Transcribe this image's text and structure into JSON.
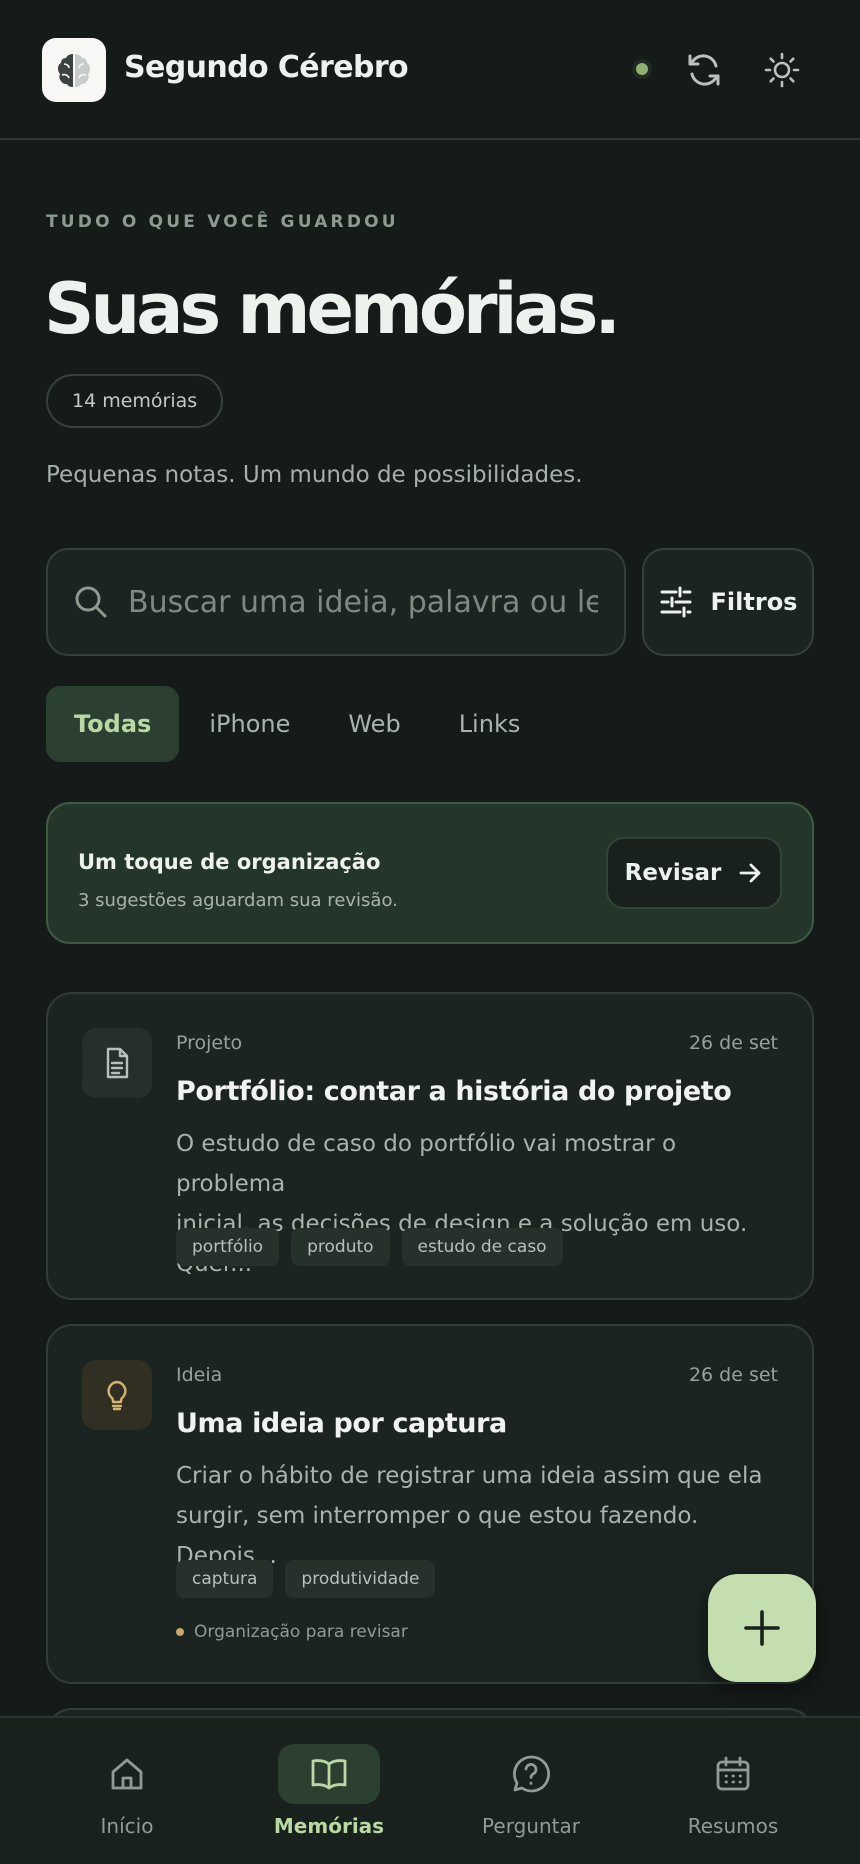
{
  "header": {
    "app_title": "Segundo Cérebro",
    "logo_icon": "brain-icon",
    "status": "online",
    "actions": [
      "sync-icon",
      "sun-icon"
    ]
  },
  "hero": {
    "eyebrow": "TUDO O QUE VOCÊ GUARDOU",
    "title": "Suas memórias.",
    "count_label": "14 memórias",
    "tagline": "Pequenas notas. Um mundo de possibilidades."
  },
  "search": {
    "placeholder": "Buscar uma ideia, palavra ou lembrança",
    "value": "",
    "filters_label": "Filtros"
  },
  "tabs": [
    {
      "label": "Todas",
      "active": true
    },
    {
      "label": "iPhone",
      "active": false
    },
    {
      "label": "Web",
      "active": false
    },
    {
      "label": "Links",
      "active": false
    }
  ],
  "banner": {
    "title": "Um toque de organização",
    "subtitle": "3 sugestões aguardam sua revisão.",
    "action_label": "Revisar"
  },
  "cards": [
    {
      "kind": "Projeto",
      "date": "26 de set",
      "icon": "document-icon",
      "title": "Portfólio: contar a história do projeto",
      "body_line1": "O estudo de caso do portfólio vai mostrar o problema",
      "body_line2": "inicial, as decisões de design e a solução em uso. Quer...",
      "tags": [
        "portfólio",
        "produto",
        "estudo de caso"
      ]
    },
    {
      "kind": "Ideia",
      "date": "26 de set",
      "icon": "lightbulb-icon",
      "title": "Uma ideia por captura",
      "body_line1": "Criar o hábito de registrar uma ideia assim que ela",
      "body_line2": "surgir, sem interromper o que estou fazendo. Depois...",
      "tags": [
        "captura",
        "produtividade"
      ],
      "note": "Organização para revisar"
    }
  ],
  "colors": {
    "background": "#141b18",
    "accent": "#c5deb0",
    "accent_text": "#b9d8a3",
    "banner_bg": "#243629"
  },
  "nav": [
    {
      "label": "Início",
      "icon": "home-icon",
      "active": false
    },
    {
      "label": "Memórias",
      "icon": "book-icon",
      "active": true
    },
    {
      "label": "Perguntar",
      "icon": "question-icon",
      "active": false
    },
    {
      "label": "Resumos",
      "icon": "calendar-icon",
      "active": false
    }
  ]
}
